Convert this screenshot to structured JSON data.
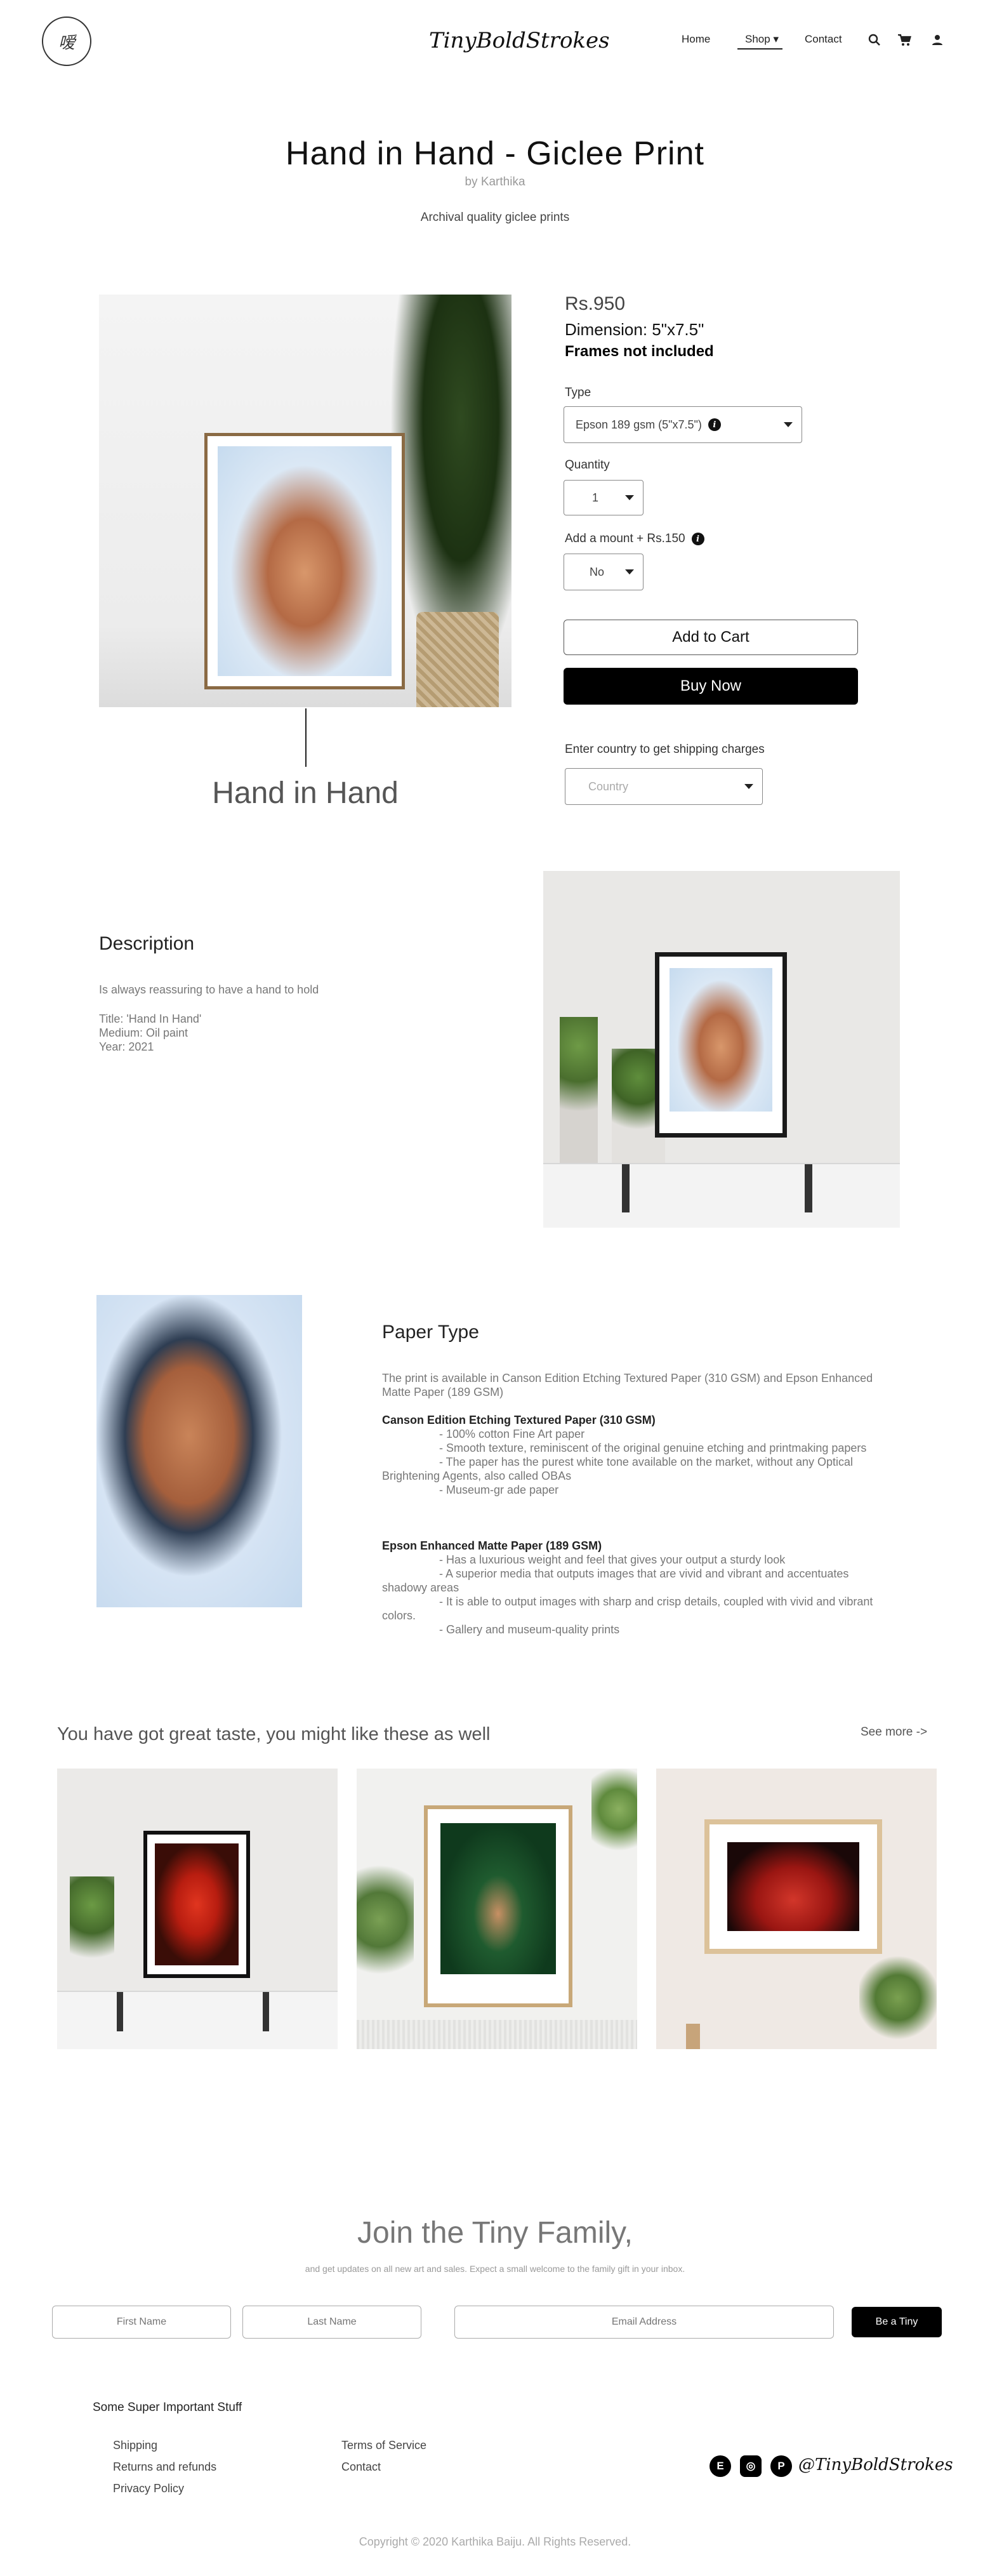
{
  "header": {
    "logo_glyph": "嗳",
    "brand": "TinyBoldStrokes",
    "nav": [
      {
        "label": "Home"
      },
      {
        "label": "Shop"
      },
      {
        "label": "Contact"
      }
    ],
    "shop_caret": "▾",
    "icons": [
      "search-icon",
      "cart-icon",
      "user-icon"
    ],
    "icon_glyphs": {
      "search": "⌕",
      "cart": "🛒",
      "user": "👤"
    }
  },
  "product": {
    "title": "Hand in Hand - Giclee Print",
    "byline": "by Karthika",
    "subtitle": "Archival quality giclee prints",
    "image_caption": "Hand in Hand",
    "price": "Rs.950",
    "dimension": "Dimension: 5\"x7.5\"",
    "frames_note": "Frames not included",
    "type_label": "Type",
    "type_value": "Epson 189 gsm (5\"x7.5\")",
    "quantity_label": "Quantity",
    "quantity_value": "1",
    "mount_label": "Add a mount + Rs.150",
    "mount_value": "No",
    "info_glyph": "i",
    "add_to_cart": "Add to Cart",
    "buy_now": "Buy Now",
    "shipping_label": "Enter country to get shipping charges",
    "country_placeholder": "Country"
  },
  "description": {
    "heading": "Description",
    "tagline": "Is always reassuring to have a hand to hold",
    "title_line": "Title: 'Hand In Hand'",
    "medium_line": "Medium: Oil paint",
    "year_line": "Year: 2021"
  },
  "paper": {
    "heading": "Paper Type",
    "intro": "The print is available in Canson Edition Etching Textured Paper (310 GSM)  and Epson Enhanced Matte Paper (189 GSM)",
    "canson_title": "Canson Edition Etching Textured Paper (310 GSM)",
    "canson_points": [
      "- 100% cotton Fine Art paper",
      "- Smooth texture, reminiscent of the original genuine  etching and printmaking papers",
      "- The paper has the purest white tone available on the market, without any Optical Brightening Agents, also called OBAs",
      "- Museum-gr ade paper"
    ],
    "epson_title": "Epson Enhanced Matte Paper (189 GSM)",
    "epson_points": [
      "- Has a luxurious weight and feel that gives your output a sturdy look",
      "- A superior media  that outputs images that are vivid and vibrant and accentuates shadowy areas",
      "- It is able to output images with sharp and crisp details, coupled with vivid and vibrant colors.",
      "- Gallery and museum-quality prints"
    ]
  },
  "related": {
    "heading": "You have got great taste, you might like these as well",
    "see_more": "See more ->"
  },
  "newsletter": {
    "heading": "Join the Tiny Family,",
    "sub": "and get updates on all new art and sales. Expect a small welcome to the family gift in your inbox.",
    "first_name_placeholder": "First Name",
    "last_name_placeholder": "Last Name",
    "email_placeholder": "Email Address",
    "submit": "Be a Tiny"
  },
  "footer": {
    "heading": "Some Super Important Stuff",
    "links_col1": [
      "Shipping",
      "Returns and refunds",
      "Privacy Policy"
    ],
    "links_col2": [
      "Terms of Service",
      "Contact"
    ],
    "social": [
      {
        "name": "etsy-icon",
        "glyph": "E"
      },
      {
        "name": "instagram-icon",
        "glyph": "◎"
      },
      {
        "name": "pinterest-icon",
        "glyph": "P"
      }
    ],
    "brand": "@TinyBoldStrokes",
    "copyright": "Copyright © 2020 Karthika Baiju. All Rights Reserved."
  }
}
